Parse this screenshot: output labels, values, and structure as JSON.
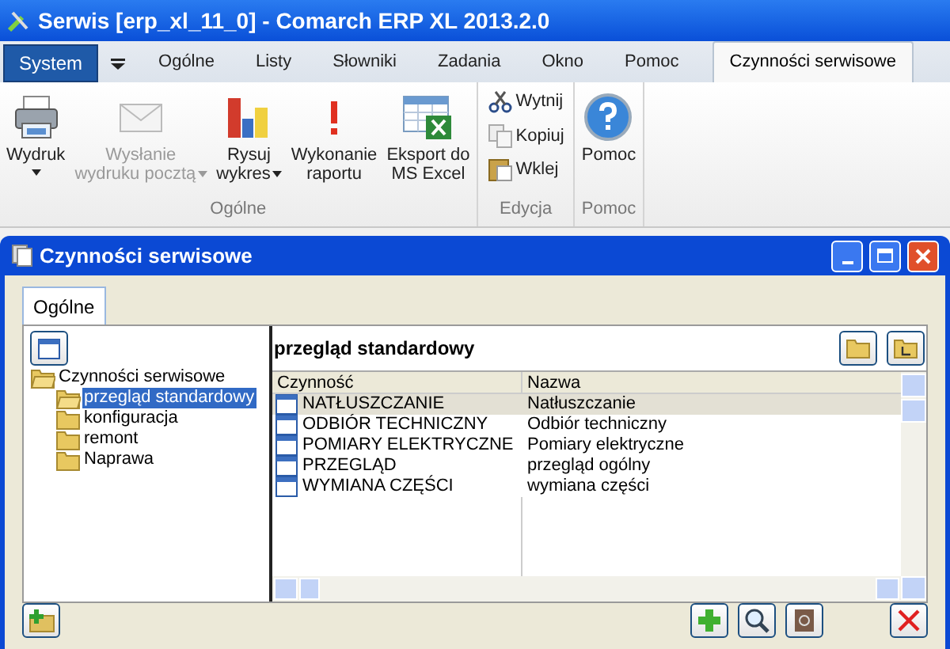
{
  "window": {
    "title": "Serwis [erp_xl_11_0] - Comarch ERP XL 2013.2.0"
  },
  "system_button": "System",
  "menu_tabs": [
    {
      "label": "Ogólne",
      "selected": false
    },
    {
      "label": "Listy",
      "selected": false
    },
    {
      "label": "Słowniki",
      "selected": false
    },
    {
      "label": "Zadania",
      "selected": false
    },
    {
      "label": "Okno",
      "selected": false
    },
    {
      "label": "Pomoc",
      "selected": false
    },
    {
      "label": "Czynności serwisowe",
      "selected": true
    }
  ],
  "ribbon_groups": [
    {
      "label": "Ogólne",
      "buttons": [
        {
          "kind": "printer",
          "lines": [
            "Wydruk"
          ],
          "dropdown": true,
          "disabled": false
        },
        {
          "kind": "mail",
          "lines": [
            "Wysłanie",
            "wydruku pocztą"
          ],
          "dropdown": true,
          "disabled": true
        },
        {
          "kind": "chart",
          "lines": [
            "Rysuj",
            "wykres"
          ],
          "dropdown": true,
          "disabled": false
        },
        {
          "kind": "alert",
          "lines": [
            "Wykonanie",
            "raportu"
          ],
          "dropdown": false,
          "disabled": false
        },
        {
          "kind": "excel",
          "lines": [
            "Eksport do",
            "MS Excel"
          ],
          "dropdown": false,
          "disabled": false
        }
      ]
    },
    {
      "label": "Edycja",
      "small": [
        {
          "kind": "cut",
          "label": "Wytnij"
        },
        {
          "kind": "copy",
          "label": "Kopiuj"
        },
        {
          "kind": "paste",
          "label": "Wklej"
        }
      ]
    },
    {
      "label": "Pomoc",
      "buttons": [
        {
          "kind": "help",
          "lines": [
            "Pomoc"
          ],
          "dropdown": false,
          "disabled": false
        }
      ]
    }
  ],
  "child_window": {
    "title": "Czynności serwisowe",
    "tabs": [
      {
        "label": "Ogólne",
        "selected": true
      }
    ],
    "tree": [
      {
        "label": "Czynności serwisowe",
        "selected": false,
        "expanded": true,
        "children": [
          {
            "label": "przegląd standardowy",
            "selected": true
          },
          {
            "label": "konfiguracja",
            "selected": false
          },
          {
            "label": "remont",
            "selected": false
          },
          {
            "label": "Naprawa",
            "selected": false
          }
        ]
      }
    ],
    "panel_title": "przegląd standardowy",
    "table": {
      "columns": [
        "Czynność",
        "Nazwa"
      ],
      "rows": [
        {
          "cells": [
            "NATŁUSZCZANIE",
            "Natłuszczanie"
          ],
          "selected": true
        },
        {
          "cells": [
            "ODBIÓR TECHNICZNY",
            "Odbiór techniczny"
          ],
          "selected": false
        },
        {
          "cells": [
            "POMIARY ELEKTRYCZNE",
            "Pomiary elektryczne"
          ],
          "selected": false
        },
        {
          "cells": [
            "PRZEGLĄD",
            "przegląd ogólny"
          ],
          "selected": false
        },
        {
          "cells": [
            "WYMIANA CZĘŚCI",
            "wymiana części"
          ],
          "selected": false
        }
      ]
    }
  }
}
